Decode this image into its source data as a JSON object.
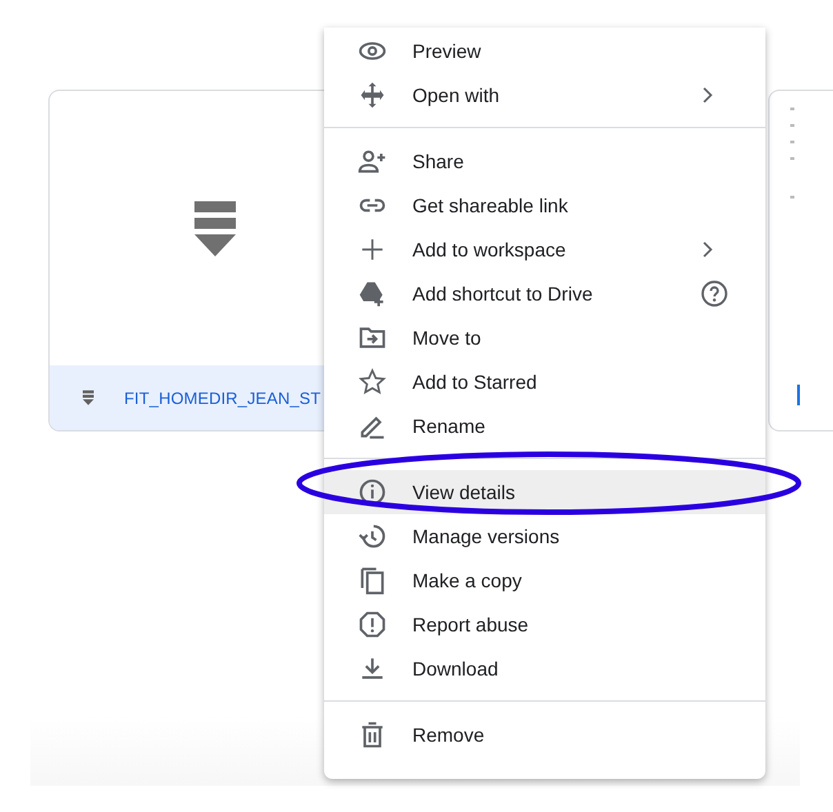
{
  "file_card": {
    "name": "FIT_HOMEDIR_JEAN_ST",
    "selected": true
  },
  "context_menu": {
    "sections": [
      [
        {
          "label": "Preview",
          "submenu": false,
          "help": false,
          "hovered": false
        },
        {
          "label": "Open with",
          "submenu": true,
          "help": false,
          "hovered": false
        }
      ],
      [
        {
          "label": "Share",
          "submenu": false,
          "help": false,
          "hovered": false
        },
        {
          "label": "Get shareable link",
          "submenu": false,
          "help": false,
          "hovered": false
        },
        {
          "label": "Add to workspace",
          "submenu": true,
          "help": false,
          "hovered": false
        },
        {
          "label": "Add shortcut to Drive",
          "submenu": false,
          "help": true,
          "hovered": false
        },
        {
          "label": "Move to",
          "submenu": false,
          "help": false,
          "hovered": false
        },
        {
          "label": "Add to Starred",
          "submenu": false,
          "help": false,
          "hovered": false
        },
        {
          "label": "Rename",
          "submenu": false,
          "help": false,
          "hovered": false
        }
      ],
      [
        {
          "label": "View details",
          "submenu": false,
          "help": false,
          "hovered": true
        },
        {
          "label": "Manage versions",
          "submenu": false,
          "help": false,
          "hovered": false
        },
        {
          "label": "Make a copy",
          "submenu": false,
          "help": false,
          "hovered": false
        },
        {
          "label": "Report abuse",
          "submenu": false,
          "help": false,
          "hovered": false
        },
        {
          "label": "Download",
          "submenu": false,
          "help": false,
          "hovered": false
        }
      ],
      [
        {
          "label": "Remove",
          "submenu": false,
          "help": false,
          "hovered": false
        }
      ]
    ]
  }
}
